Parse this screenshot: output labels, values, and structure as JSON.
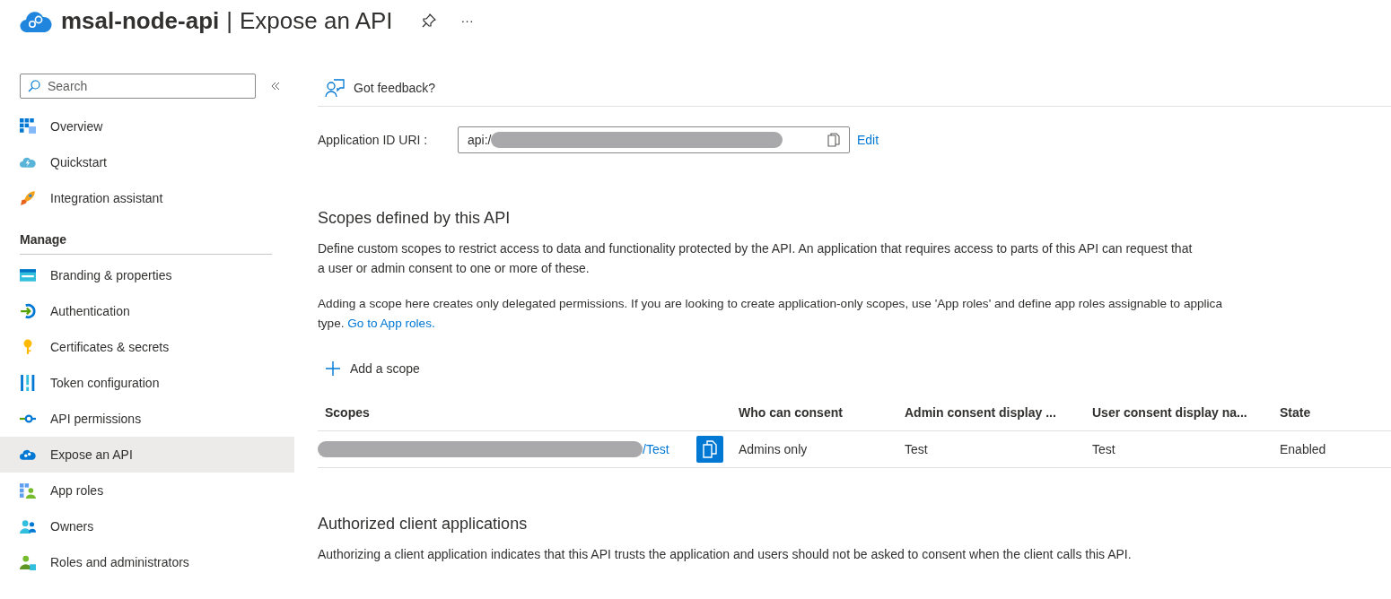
{
  "header": {
    "app_name": "msal-node-api",
    "separator": "|",
    "page_title": "Expose an API",
    "more": "···"
  },
  "sidebar": {
    "search": {
      "placeholder": "Search"
    },
    "items": [
      {
        "label": "Overview",
        "kind": "overview",
        "selected": false
      },
      {
        "label": "Quickstart",
        "kind": "quickstart",
        "selected": false
      },
      {
        "label": "Integration assistant",
        "kind": "rocket",
        "selected": false
      }
    ],
    "sections": [
      {
        "heading": "Manage",
        "items": [
          {
            "label": "Branding & properties",
            "kind": "branding",
            "selected": false
          },
          {
            "label": "Authentication",
            "kind": "auth",
            "selected": false
          },
          {
            "label": "Certificates & secrets",
            "kind": "key",
            "selected": false
          },
          {
            "label": "Token configuration",
            "kind": "token",
            "selected": false
          },
          {
            "label": "API permissions",
            "kind": "permissions",
            "selected": false
          },
          {
            "label": "Expose an API",
            "kind": "expose",
            "selected": true
          },
          {
            "label": "App roles",
            "kind": "roles",
            "selected": false
          },
          {
            "label": "Owners",
            "kind": "owners",
            "selected": false
          },
          {
            "label": "Roles and administrators",
            "kind": "admins",
            "selected": false
          }
        ]
      }
    ]
  },
  "toolbar": {
    "feedback": "Got feedback?"
  },
  "app_id_uri": {
    "label": "Application ID URI :",
    "value": "api:/",
    "edit": "Edit"
  },
  "scopes": {
    "title": "Scopes defined by this API",
    "description": "Define custom scopes to restrict access to data and functionality protected by the API. An application that requires access to parts of this API can request that a user or admin consent to one or more of these.",
    "note": {
      "text": "Adding a scope here creates only delegated permissions. If you are looking to create application-only scopes, use 'App roles' and define app roles assignable to applica",
      "continuation": "type.",
      "link": "Go to App roles."
    },
    "add_button": "Add a scope",
    "table": {
      "columns": [
        "Scopes",
        "Who can consent",
        "Admin consent display ...",
        "User consent display na...",
        "State"
      ],
      "rows": [
        {
          "scope": "/Test",
          "who_can_consent": "Admins only",
          "admin_consent_display": "Test",
          "user_consent_display": "Test",
          "state": "Enabled"
        }
      ]
    }
  },
  "authorized_clients": {
    "title": "Authorized client applications",
    "description": "Authorizing a client application indicates that this API trusts the application and users should not be asked to consent when the client calls this API."
  }
}
